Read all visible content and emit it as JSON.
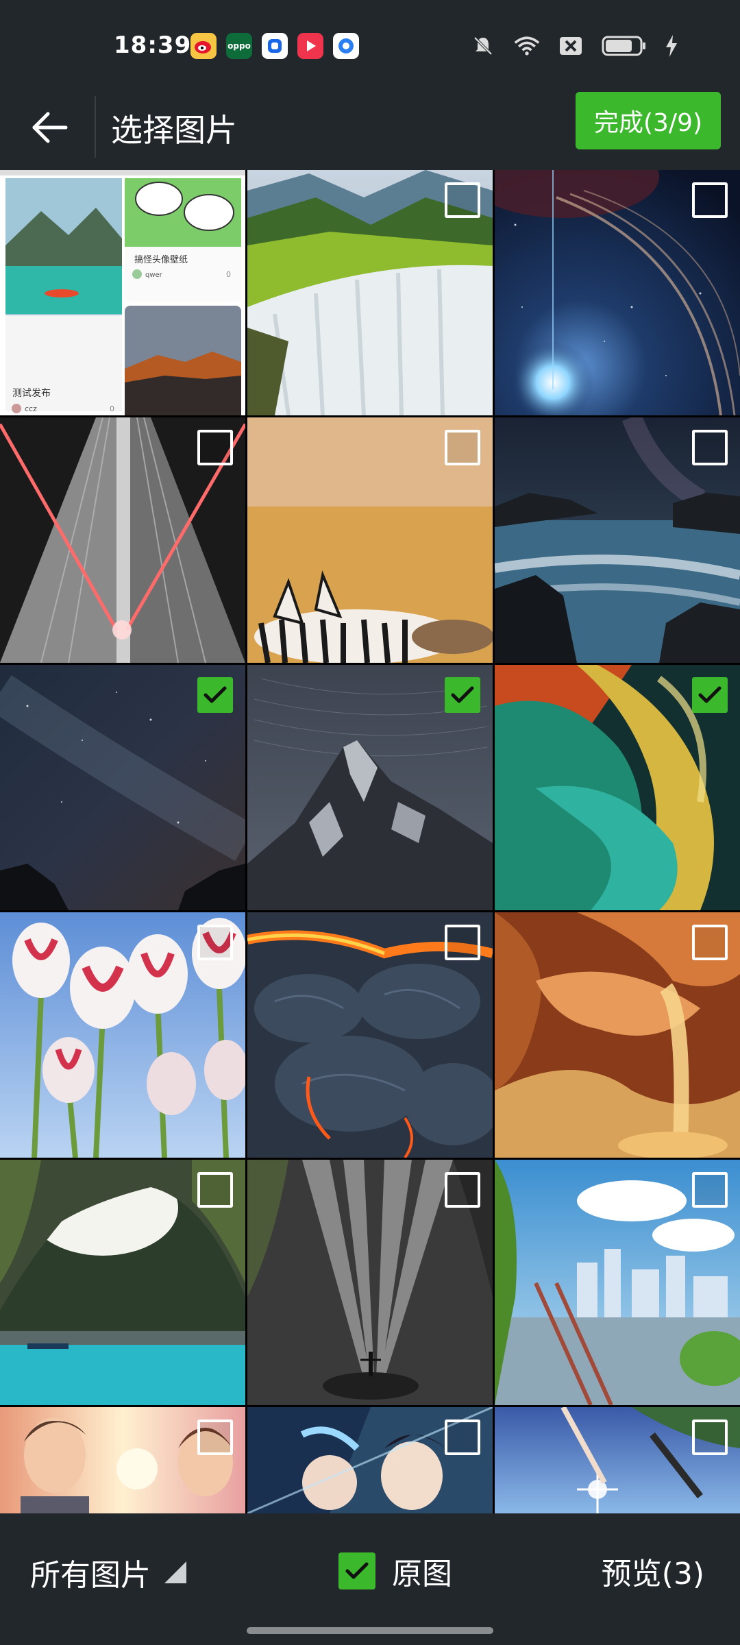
{
  "status_bar": {
    "time": "18:39",
    "app_icons": [
      "weibo-icon",
      "oppo-icon",
      "app-icon-blue",
      "video-icon-red",
      "app-icon-blue-2"
    ],
    "oppo_label": "oppo",
    "system_icons": [
      "mute-icon",
      "wifi-icon",
      "close-box-icon",
      "battery-icon",
      "charging-icon"
    ]
  },
  "app_bar": {
    "title": "选择图片",
    "done_label": "完成(3/9)"
  },
  "grid": {
    "columns": 3,
    "tiles": [
      {
        "name": "app-screenshot-tile",
        "checked": false,
        "has_checkbox": false,
        "caption_a": "测试发布",
        "caption_b": "搞怪头像壁纸",
        "user_a": "ccz",
        "user_b": "qwer",
        "count_a": "0",
        "count_b": "0"
      },
      {
        "name": "waterfall-tile",
        "checked": false,
        "has_checkbox": true
      },
      {
        "name": "space-planet-tile",
        "checked": false,
        "has_checkbox": true
      },
      {
        "name": "skyscraper-lasers-tile",
        "checked": false,
        "has_checkbox": true
      },
      {
        "name": "zebras-tile",
        "checked": false,
        "has_checkbox": true
      },
      {
        "name": "rocky-coast-night-tile",
        "checked": false,
        "has_checkbox": true
      },
      {
        "name": "milky-way-tile",
        "checked": true,
        "has_checkbox": true
      },
      {
        "name": "mountain-peak-night-tile",
        "checked": true,
        "has_checkbox": true
      },
      {
        "name": "abstract-swirl-tile",
        "checked": true,
        "has_checkbox": true
      },
      {
        "name": "tulips-tile",
        "checked": false,
        "has_checkbox": true
      },
      {
        "name": "lava-tile",
        "checked": false,
        "has_checkbox": true
      },
      {
        "name": "canyon-tile",
        "checked": false,
        "has_checkbox": true
      },
      {
        "name": "sea-cave-tile",
        "checked": false,
        "has_checkbox": true
      },
      {
        "name": "light-rays-cave-tile",
        "checked": false,
        "has_checkbox": true
      },
      {
        "name": "anime-city-tile",
        "checked": false,
        "has_checkbox": true
      },
      {
        "name": "anime-couple-tile",
        "checked": false,
        "has_checkbox": true
      },
      {
        "name": "anime-blue-tile",
        "checked": false,
        "has_checkbox": true
      },
      {
        "name": "anime-sparkle-tile",
        "checked": false,
        "has_checkbox": true
      }
    ]
  },
  "bottom_bar": {
    "album_label": "所有图片",
    "original_label": "原图",
    "original_checked": true,
    "preview_label": "预览(3)"
  },
  "colors": {
    "accent": "#3cb82d",
    "bar_bg": "#22272b"
  }
}
